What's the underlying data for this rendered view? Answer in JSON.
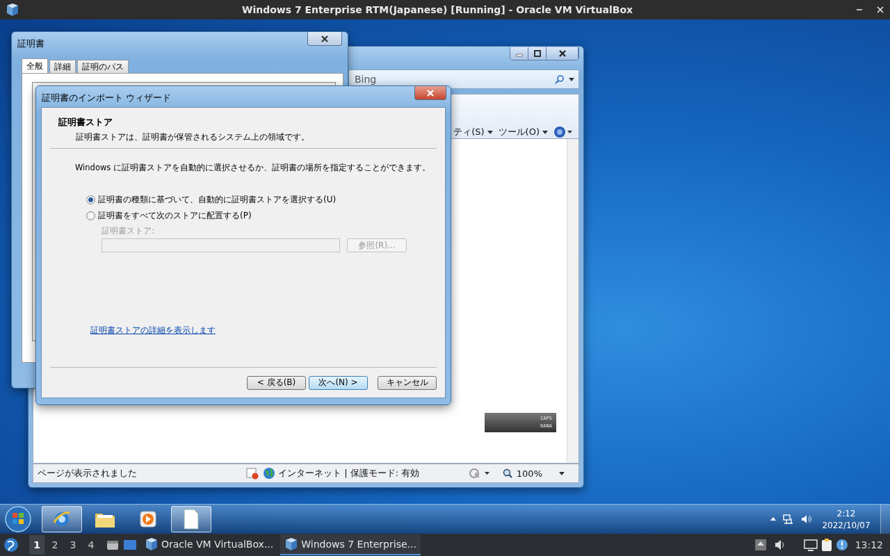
{
  "host_window": {
    "title": "Windows 7 Enterprise RTM(Japanese) [Running] - Oracle VM VirtualBox"
  },
  "ie_window": {
    "search_placeholder": "Bing",
    "menu": [
      {
        "label": "ティ(S)"
      },
      {
        "label": "ツール(O)"
      }
    ],
    "status_text": "ページが表示されました",
    "zone": "インターネット | 保護モード: 有効",
    "zoom": "100%"
  },
  "cert_window": {
    "title": "証明書",
    "tabs": [
      {
        "label": "全般",
        "selected": true
      },
      {
        "label": "詳細",
        "selected": false
      },
      {
        "label": "証明のパス",
        "selected": false
      }
    ]
  },
  "wizard": {
    "title": "証明書のインポート ウィザード",
    "heading": "証明書ストア",
    "subheading": "証明書ストアは、証明書が保管されるシステム上の領域です。",
    "intro": "Windows に証明書ストアを自動的に選択させるか、証明書の場所を指定することができます。",
    "options": [
      {
        "label": "証明書の種類に基づいて、自動的に証明書ストアを選択する(U)",
        "selected": true
      },
      {
        "label": "証明書をすべて次のストアに配置する(P)",
        "selected": false
      }
    ],
    "store_label": "証明書ストア:",
    "store_disabled": true,
    "browse_button": "参照(R)...",
    "link": "証明書ストアの詳細を表示します",
    "buttons": [
      {
        "label": "< 戻る(B)",
        "default": false
      },
      {
        "label": "次へ(N) >",
        "default": true
      },
      {
        "label": "キャンセル",
        "default": false
      }
    ]
  },
  "ime_bar": {
    "labels": [
      "CAPS",
      "KANA"
    ]
  },
  "guest_taskbar": {
    "pinned": [
      {
        "kind": "browser",
        "active": true
      },
      {
        "kind": "folder",
        "active": false
      },
      {
        "kind": "media",
        "active": false
      },
      {
        "kind": "document",
        "active": true
      }
    ],
    "time": "2:12",
    "date": "2022/10/07"
  },
  "host_panel": {
    "workspaces": [
      {
        "label": "1",
        "selected": true
      },
      {
        "label": "2",
        "selected": false
      },
      {
        "label": "3",
        "selected": false
      },
      {
        "label": "4",
        "selected": false
      }
    ],
    "tasks": [
      {
        "label": "Oracle VM VirtualBox...",
        "selected": false
      },
      {
        "label": "Windows 7 Enterprise...",
        "selected": true
      }
    ],
    "clock": "13:12"
  }
}
